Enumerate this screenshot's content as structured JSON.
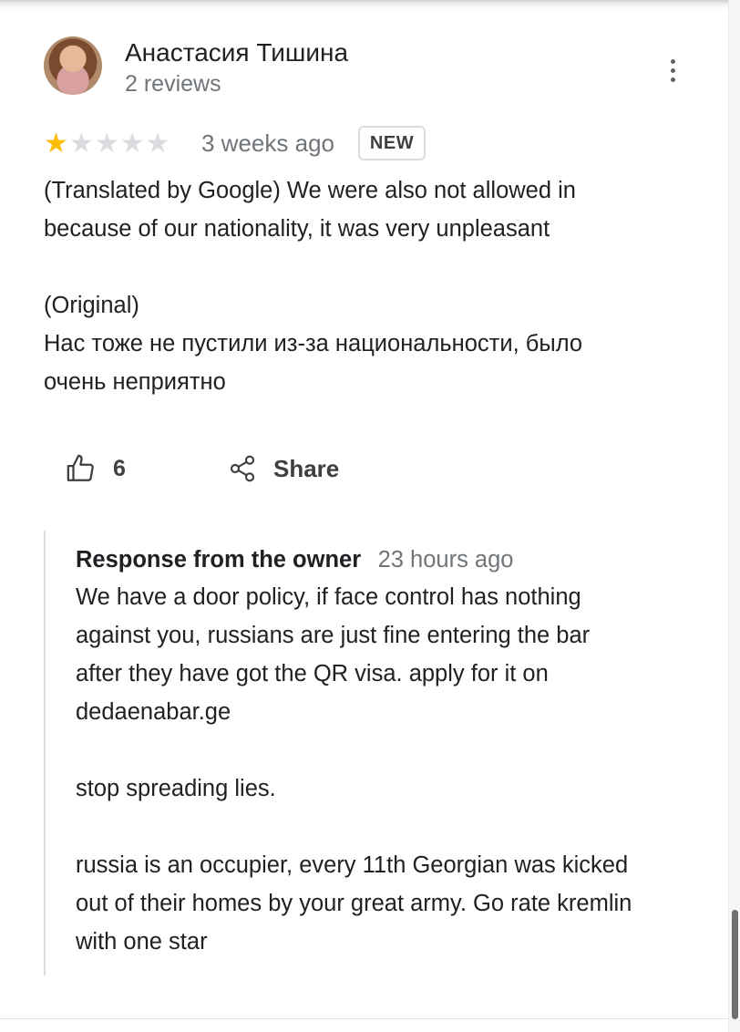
{
  "review": {
    "author_name": "Анастасия Тишина",
    "author_meta": "2 reviews",
    "rating": 1,
    "rating_max": 5,
    "time": "3 weeks ago",
    "badge": "NEW",
    "text_translated_1": "(Translated by Google) We were also not allowed in",
    "text_translated_2": "because of our nationality, it was very unpleasant",
    "text_original_label": "(Original)",
    "text_original_1": "Нас тоже не пустили из-за национальности, было",
    "text_original_2": "очень неприятно"
  },
  "actions": {
    "like_count": "6",
    "share_label": "Share"
  },
  "owner_response": {
    "title": "Response from the owner",
    "time": "23 hours ago",
    "lines": [
      "We have a door policy, if face control has nothing",
      "against you, russians are just fine entering the bar",
      "after they have got the QR visa. apply for it on",
      "dedaenabar.ge",
      "",
      "stop spreading lies.",
      "",
      "russia is an occupier, every 11th Georgian was kicked",
      "out of their homes by your great army. Go rate kremlin",
      "with one star"
    ]
  },
  "colors": {
    "star_filled": "#fbbc04",
    "star_empty": "#dadce0",
    "secondary_text": "#70757a",
    "primary_text": "#202124"
  },
  "icons": [
    "more-vert-icon",
    "star-icon",
    "thumb-up-icon",
    "share-icon"
  ]
}
